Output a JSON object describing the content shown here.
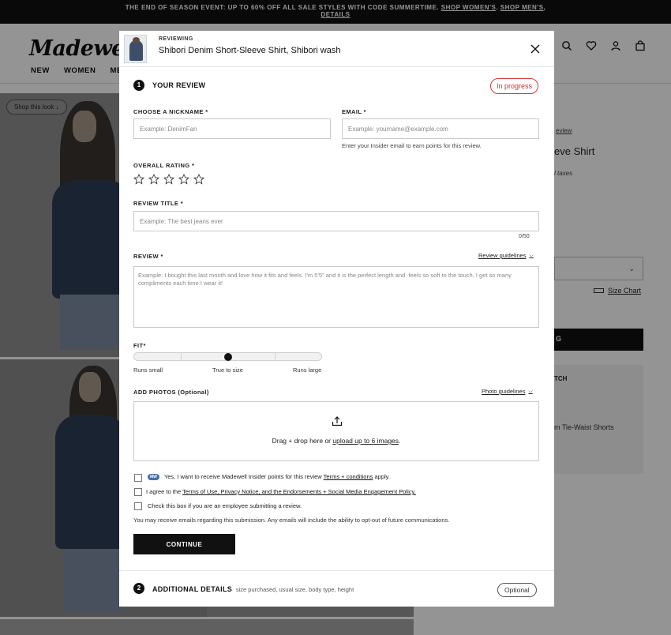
{
  "promo": {
    "text": "THE END OF SEASON EVENT: UP TO 60% OFF ALL SALE STYLES WITH CODE SUMMERTIME.",
    "link_women": "SHOP WOMEN'S",
    "link_men": "SHOP MEN'S",
    "link_details": "DETAILS"
  },
  "header": {
    "logo": "Madewell",
    "nav": [
      "NEW",
      "WOMEN",
      "ME"
    ],
    "icons": [
      "search-icon",
      "heart-icon",
      "account-icon",
      "bag-icon"
    ]
  },
  "background": {
    "shop_look": "Shop this look",
    "review_link": "eview",
    "product_title": "eve Shirt",
    "taxes": "l taxes",
    "size_chart": "Size Chart",
    "add_to_bag_fragment": "G",
    "match_fragment": "TCH",
    "match_item": "m Tie-Waist Shorts"
  },
  "modal": {
    "reviewing_label": "REVIEWING",
    "product_name": "Shibori Denim Short-Sleeve Shirt, Shibori wash",
    "section1": {
      "number": "1",
      "title": "YOUR REVIEW",
      "status": "In progress"
    },
    "nickname": {
      "label": "CHOOSE A NICKNAME *",
      "placeholder": "Example: DenimFan",
      "value": ""
    },
    "email": {
      "label": "EMAIL *",
      "placeholder": "Example: yourname@example.com",
      "value": "",
      "help": "Enter your Insider email to earn points for this review."
    },
    "rating": {
      "label": "OVERALL RATING *",
      "max": 5,
      "value": 0
    },
    "title": {
      "label": "REVIEW TITLE *",
      "placeholder": "Example: The best jeans ever",
      "counter": "0/50"
    },
    "review": {
      "label": "REVIEW *",
      "guidelines": "Review guidelines",
      "placeholder": "Example: I bought this last month and love how it fits and feels. I'm 5'5\" and it is the perfect length and  feels so soft to the touch. I get so many compliments each time I wear it!"
    },
    "fit": {
      "label": "FIT*",
      "value": 0.5,
      "labels": [
        "Runs small",
        "True to size",
        "Runs large"
      ]
    },
    "photos": {
      "label": "ADD PHOTOS (Optional)",
      "guidelines": "Photo guidelines",
      "drop_text": "Drag + drop here or ",
      "upload_link": "upload up to 6 images",
      "drop_end": "."
    },
    "checkboxes": {
      "insider_badge": "MW",
      "insider_text": "Yes, I want to receive Madewell Insider points for this review ",
      "insider_link": "Terms + conditions",
      "insider_end": " apply.",
      "terms_text": "I agree to the ",
      "terms_link": "Terms of Use, Privacy Notice, and the Endorsements + Social Media Engagement Policy.",
      "employee_text": "Check this box if you are an employee submitting a review."
    },
    "note": "You may receive emails regarding this submission. Any emails will include the ability to opt-out of future communications.",
    "continue_label": "CONTINUE",
    "section2": {
      "number": "2",
      "title": "ADDITIONAL DETAILS",
      "subtitle": "size purchased, usual size, body type, height",
      "status": "Optional"
    }
  }
}
